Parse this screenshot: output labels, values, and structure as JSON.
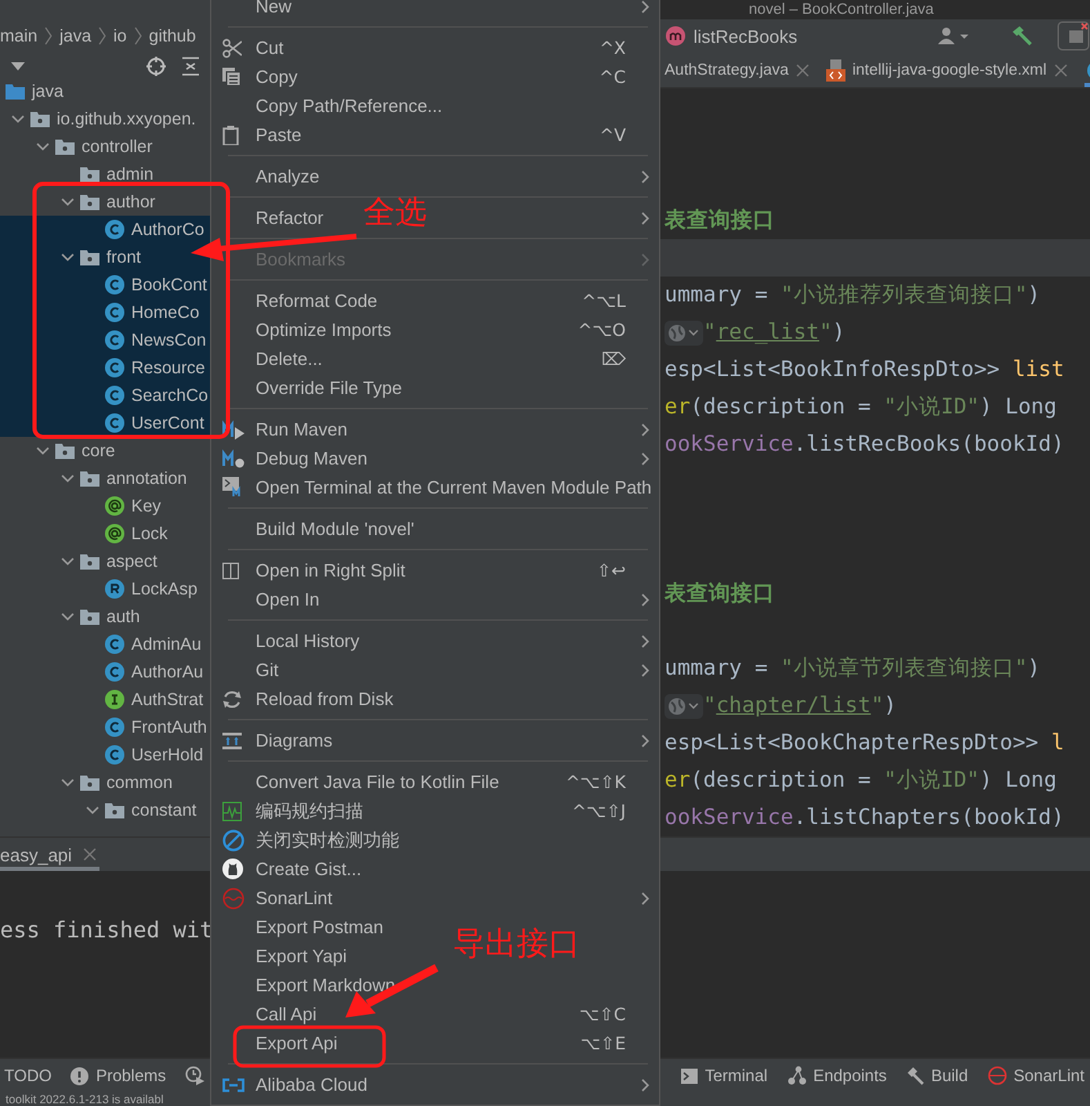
{
  "title": "novel – BookController.java",
  "breadcrumbs": [
    "main",
    "java",
    "io",
    "github"
  ],
  "navigation_bar": {
    "method": "listRecBooks"
  },
  "project_tree": [
    {
      "label": "java",
      "kind": "source-root",
      "selected": false,
      "children": [
        {
          "label": "io.github.xxyopen.",
          "kind": "package",
          "expanded": true,
          "selected": false,
          "children": [
            {
              "label": "controller",
              "kind": "package",
              "expanded": true,
              "selected": false,
              "children": [
                {
                  "label": "admin",
                  "kind": "package",
                  "selected": false
                },
                {
                  "label": "author",
                  "kind": "package",
                  "expanded": true,
                  "selected": false,
                  "children": [
                    {
                      "label": "AuthorCo",
                      "kind": "class",
                      "selected": true
                    }
                  ]
                },
                {
                  "label": "front",
                  "kind": "package",
                  "expanded": true,
                  "selected": true,
                  "children": [
                    {
                      "label": "BookCont",
                      "kind": "class",
                      "selected": true
                    },
                    {
                      "label": "HomeCo",
                      "kind": "class",
                      "selected": true
                    },
                    {
                      "label": "NewsCon",
                      "kind": "class",
                      "selected": true
                    },
                    {
                      "label": "Resource",
                      "kind": "class",
                      "selected": true
                    },
                    {
                      "label": "SearchCo",
                      "kind": "class",
                      "selected": true
                    },
                    {
                      "label": "UserCont",
                      "kind": "class",
                      "selected": true
                    }
                  ]
                }
              ]
            },
            {
              "label": "core",
              "kind": "package",
              "expanded": true,
              "selected": false,
              "children": [
                {
                  "label": "annotation",
                  "kind": "package",
                  "expanded": true,
                  "selected": false,
                  "children": [
                    {
                      "label": "Key",
                      "kind": "annotation",
                      "selected": false
                    },
                    {
                      "label": "Lock",
                      "kind": "annotation",
                      "selected": false
                    }
                  ]
                },
                {
                  "label": "aspect",
                  "kind": "package",
                  "expanded": true,
                  "selected": false,
                  "children": [
                    {
                      "label": "LockAsp",
                      "kind": "r-class",
                      "selected": false
                    }
                  ]
                },
                {
                  "label": "auth",
                  "kind": "package",
                  "expanded": true,
                  "selected": false,
                  "children": [
                    {
                      "label": "AdminAu",
                      "kind": "class",
                      "selected": false
                    },
                    {
                      "label": "AuthorAu",
                      "kind": "class",
                      "selected": false
                    },
                    {
                      "label": "AuthStrat",
                      "kind": "interface",
                      "selected": false
                    },
                    {
                      "label": "FrontAuth",
                      "kind": "class",
                      "selected": false
                    },
                    {
                      "label": "UserHold",
                      "kind": "class",
                      "selected": false
                    }
                  ]
                },
                {
                  "label": "common",
                  "kind": "package",
                  "expanded": true,
                  "selected": false,
                  "children": [
                    {
                      "label": "constant",
                      "kind": "package",
                      "expanded": true,
                      "selected": false
                    }
                  ]
                }
              ]
            }
          ]
        }
      ]
    }
  ],
  "editor_tabs": [
    {
      "label": "AuthStrategy.java",
      "selected": false
    },
    {
      "label": "intellij-java-google-style.xml",
      "kind": "xml",
      "selected": false
    },
    {
      "kind": "java",
      "selected": true
    }
  ],
  "code_lines": [
    {
      "kind": "blank",
      "current": false
    },
    {
      "kind": "blank",
      "current": false
    },
    {
      "kind": "blank",
      "current": false
    },
    {
      "kind": "code",
      "current": false,
      "endpoint_inlay": false,
      "segments": [
        {
          "text": "表查询接口",
          "kind": "doc"
        }
      ]
    },
    {
      "kind": "blank",
      "current": true
    },
    {
      "kind": "code",
      "current": false,
      "endpoint_inlay": false,
      "segments": [
        {
          "text": "ummary = ",
          "kind": "plain"
        },
        {
          "text": "\"小说推荐列表查询接口\"",
          "kind": "string"
        },
        {
          "text": ")",
          "kind": "plain"
        }
      ]
    },
    {
      "kind": "code",
      "current": false,
      "endpoint_inlay": true,
      "segments": [
        {
          "text": "\"",
          "kind": "string"
        },
        {
          "text": "rec_list",
          "kind": "link"
        },
        {
          "text": "\"",
          "kind": "string"
        },
        {
          "text": ")",
          "kind": "plain"
        }
      ]
    },
    {
      "kind": "code",
      "current": false,
      "endpoint_inlay": false,
      "segments": [
        {
          "text": "esp<List<BookInfoRespDto>> ",
          "kind": "plain"
        },
        {
          "text": "list",
          "kind": "method"
        }
      ]
    },
    {
      "kind": "code",
      "current": false,
      "endpoint_inlay": false,
      "segments": [
        {
          "text": "er",
          "kind": "annotation"
        },
        {
          "text": "(description = ",
          "kind": "plain"
        },
        {
          "text": "\"小说ID\"",
          "kind": "string"
        },
        {
          "text": ") Long",
          "kind": "plain"
        }
      ]
    },
    {
      "kind": "code",
      "current": false,
      "endpoint_inlay": false,
      "segments": [
        {
          "text": "ookService",
          "kind": "field"
        },
        {
          "text": ".listRecBooks(bookId)",
          "kind": "plain"
        }
      ]
    },
    {
      "kind": "blank",
      "current": false
    },
    {
      "kind": "blank",
      "current": false
    },
    {
      "kind": "blank",
      "current": false
    },
    {
      "kind": "code",
      "current": false,
      "endpoint_inlay": false,
      "segments": [
        {
          "text": "表查询接口",
          "kind": "doc"
        }
      ]
    },
    {
      "kind": "blank",
      "current": false
    },
    {
      "kind": "code",
      "current": false,
      "endpoint_inlay": false,
      "segments": [
        {
          "text": "ummary = ",
          "kind": "plain"
        },
        {
          "text": "\"小说章节列表查询接口\"",
          "kind": "string"
        },
        {
          "text": ")",
          "kind": "plain"
        }
      ]
    },
    {
      "kind": "code",
      "current": false,
      "endpoint_inlay": true,
      "segments": [
        {
          "text": "\"",
          "kind": "string"
        },
        {
          "text": "chapter/list",
          "kind": "link"
        },
        {
          "text": "\"",
          "kind": "string"
        },
        {
          "text": ")",
          "kind": "plain"
        }
      ]
    },
    {
      "kind": "code",
      "current": false,
      "endpoint_inlay": false,
      "segments": [
        {
          "text": "esp<List<BookChapterRespDto>> ",
          "kind": "plain"
        },
        {
          "text": "l",
          "kind": "method"
        }
      ]
    },
    {
      "kind": "code",
      "current": false,
      "endpoint_inlay": false,
      "segments": [
        {
          "text": "er",
          "kind": "annotation"
        },
        {
          "text": "(description = ",
          "kind": "plain"
        },
        {
          "text": "\"小说ID\"",
          "kind": "string"
        },
        {
          "text": ") Long",
          "kind": "plain"
        }
      ]
    },
    {
      "kind": "code",
      "current": false,
      "endpoint_inlay": false,
      "segments": [
        {
          "text": "ookService",
          "kind": "field"
        },
        {
          "text": ".listChapters(bookId)",
          "kind": "plain"
        }
      ]
    }
  ],
  "context_menu": [
    [
      {
        "label": "New",
        "submenu": true,
        "disabled": false
      }
    ],
    [
      {
        "label": "Cut",
        "shortcut": "^X",
        "submenu": false,
        "disabled": false
      },
      {
        "label": "Copy",
        "shortcut": "^C",
        "submenu": false,
        "disabled": false
      },
      {
        "label": "Copy Path/Reference...",
        "submenu": false,
        "disabled": false
      },
      {
        "label": "Paste",
        "shortcut": "^V",
        "submenu": false,
        "disabled": false
      }
    ],
    [
      {
        "label": "Analyze",
        "submenu": true,
        "disabled": false
      }
    ],
    [
      {
        "label": "Refactor",
        "submenu": true,
        "disabled": false
      }
    ],
    [
      {
        "label": "Bookmarks",
        "submenu": true,
        "disabled": true
      }
    ],
    [
      {
        "label": "Reformat Code",
        "shortcut": "^⌥L",
        "submenu": false,
        "disabled": false
      },
      {
        "label": "Optimize Imports",
        "shortcut": "^⌥O",
        "submenu": false,
        "disabled": false
      },
      {
        "label": "Delete...",
        "shortcut": "⌦",
        "submenu": false,
        "disabled": false
      },
      {
        "label": "Override File Type",
        "submenu": false,
        "disabled": false
      }
    ],
    [
      {
        "label": "Run Maven",
        "submenu": true,
        "disabled": false
      },
      {
        "label": "Debug Maven",
        "submenu": true,
        "disabled": false
      },
      {
        "label": "Open Terminal at the Current Maven Module Path",
        "submenu": false,
        "disabled": false
      }
    ],
    [
      {
        "label": "Build Module 'novel'",
        "submenu": false,
        "disabled": false
      }
    ],
    [
      {
        "label": "Open in Right Split",
        "shortcut": "⇧↩",
        "submenu": false,
        "disabled": false
      },
      {
        "label": "Open In",
        "submenu": true,
        "disabled": false
      }
    ],
    [
      {
        "label": "Local History",
        "submenu": true,
        "disabled": false
      },
      {
        "label": "Git",
        "submenu": true,
        "disabled": false
      },
      {
        "label": "Reload from Disk",
        "submenu": false,
        "disabled": false
      }
    ],
    [
      {
        "label": "Diagrams",
        "submenu": true,
        "disabled": false
      }
    ],
    [
      {
        "label": "Convert Java File to Kotlin File",
        "shortcut": "^⌥⇧K",
        "submenu": false,
        "disabled": false
      },
      {
        "label": "编码规约扫描",
        "shortcut": "^⌥⇧J",
        "submenu": false,
        "disabled": false
      },
      {
        "label": "关闭实时检测功能",
        "submenu": false,
        "disabled": false
      },
      {
        "label": "Create Gist...",
        "submenu": false,
        "disabled": false
      },
      {
        "label": "SonarLint",
        "submenu": true,
        "disabled": false
      },
      {
        "label": "Export Postman",
        "submenu": false,
        "disabled": false
      },
      {
        "label": "Export Yapi",
        "submenu": false,
        "disabled": false
      },
      {
        "label": "Export Markdown",
        "submenu": false,
        "disabled": false
      },
      {
        "label": "Call Api",
        "shortcut": "⌥⇧C",
        "submenu": false,
        "disabled": false
      },
      {
        "label": "Export Api",
        "shortcut": "⌥⇧E",
        "submenu": false,
        "disabled": false
      }
    ],
    [
      {
        "label": "Alibaba Cloud",
        "submenu": true,
        "disabled": false
      }
    ]
  ],
  "bottom_panel": {
    "tabs": [
      {
        "label": "easy_api",
        "selected": true
      }
    ],
    "console": "ess finished wit"
  },
  "tool_strip": {
    "left": [
      "TODO",
      "Problems"
    ],
    "right": [
      "Terminal",
      "Endpoints",
      "Build",
      "SonarLint"
    ]
  },
  "status_bar": "toolkit 2022.6.1-213 is availabl",
  "annotations": [
    "全选",
    "导出接口"
  ]
}
